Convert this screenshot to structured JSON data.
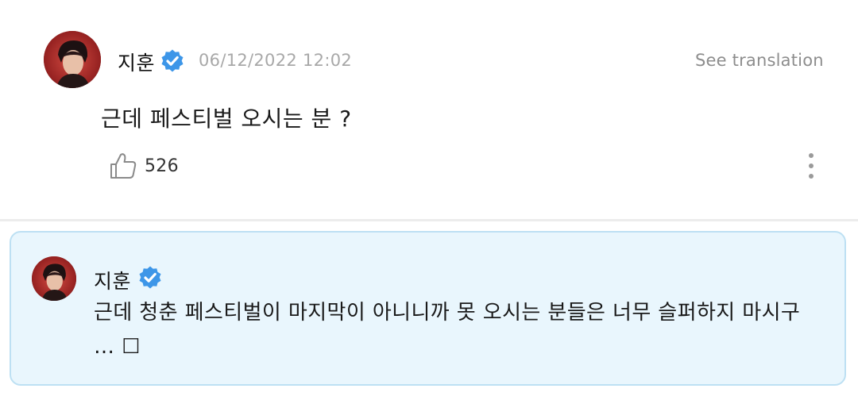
{
  "colors": {
    "verified_badge": "#3d96e8",
    "reply_background": "#e9f6fd",
    "reply_border": "#bde0f3",
    "timestamp": "#a8a8a8"
  },
  "icons": {
    "verified": "verified-badge-icon",
    "like": "thumbs-up-icon",
    "more": "vertical-ellipsis-icon",
    "avatar": "profile-photo"
  },
  "post": {
    "author": "지훈",
    "timestamp": "06/12/2022 12:02",
    "see_translation": "See translation",
    "body": "근데 페스티벌 오시는 분 ?",
    "like_count": "526"
  },
  "reply": {
    "author": "지훈",
    "body": "근데 청춘 페스티벌이 마지막이 아니니까 못 오시는 분들은 너무 슬퍼하지 마시구 … ☐"
  }
}
